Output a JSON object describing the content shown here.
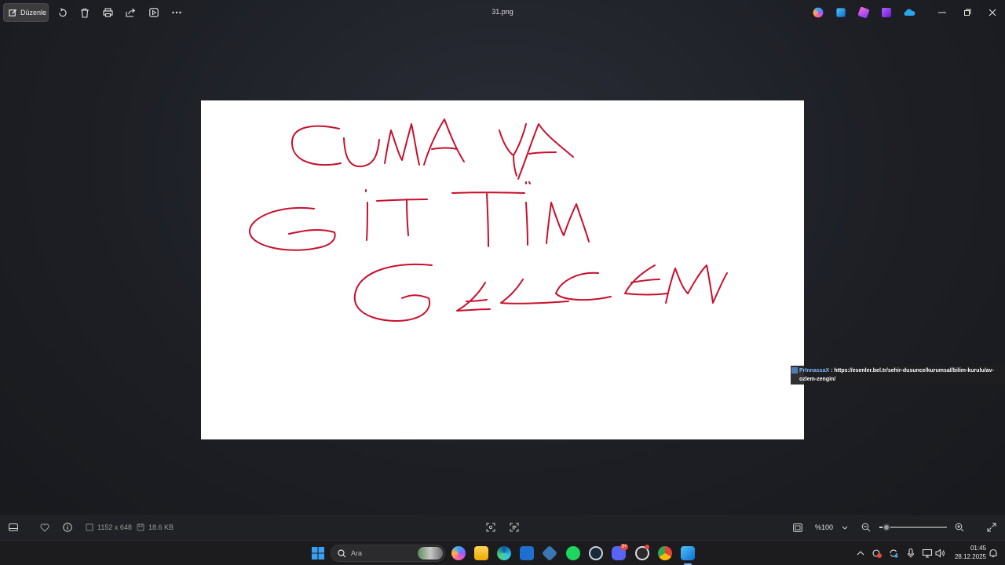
{
  "topbar": {
    "edit_label": "Düzenle",
    "file_title": "31.png",
    "icons": [
      "edit-icon",
      "rotate-icon",
      "delete-icon",
      "print-icon",
      "share-icon",
      "slideshow-icon",
      "more-icon"
    ],
    "app_icons": [
      "copilot-icon",
      "photos-app-icon",
      "designer-icon",
      "clipchamp-icon",
      "onedrive-icon"
    ]
  },
  "image": {
    "lines": [
      "CUMA YA",
      "GİTTİM",
      "GELCEM"
    ],
    "ink_color": "#c8102e"
  },
  "overlay_note": {
    "user": "PrInnassaX",
    "separator": " : ",
    "text": "https://esenler.bel.tr/sehir-dusunce/kurumsal/bilim-kurulu/av-ozlem-zengin/"
  },
  "bottombar": {
    "dimensions": "1152 x 648",
    "file_size": "18.6 KB",
    "zoom_value": "%100",
    "zoom_level_fraction": 0.1
  },
  "taskbar": {
    "search_placeholder": "Ara",
    "time": "01:45",
    "date": "28.12.2025",
    "apps": [
      "start-icon",
      "file-explorer-icon",
      "edge-icon",
      "store-icon",
      "vpn-icon",
      "spotify-icon",
      "steam-icon",
      "discord-icon",
      "obs-icon",
      "chrome-icon",
      "photos-icon"
    ],
    "discord_badge": "9+"
  },
  "colors": {
    "background": "#1d1f25",
    "toolbar": "#202124",
    "taskbar": "#1c1c1e",
    "accent": "#0067c0"
  }
}
